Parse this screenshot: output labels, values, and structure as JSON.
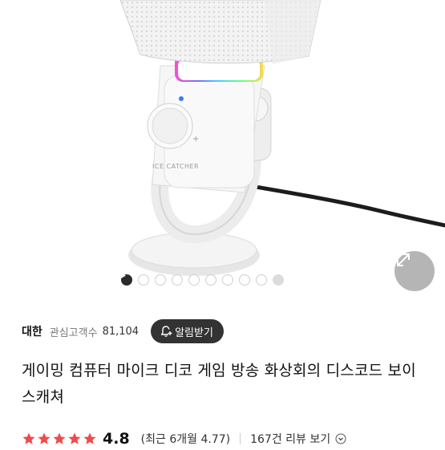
{
  "product_images": {
    "mic_label": "ICE CATCHER",
    "total_slides": 10,
    "active_slide": 1
  },
  "store": {
    "name": "대한",
    "fans_label": "관심고객수",
    "fans_count": "81,104",
    "alarm_label": "알림받기"
  },
  "product": {
    "title": "게이밍 컴퓨터 마이크 디코 게임 방송 화상회의 디스코드 보이스캐쳐"
  },
  "rating": {
    "stars": 5,
    "value": "4.8",
    "recent": "(최근 6개월 4.77)",
    "review_link": "167건 리뷰 보기"
  },
  "colors": {
    "star": "#f04a4a",
    "alarm_bg": "#333333",
    "active_dot": "#2b2b2b"
  }
}
